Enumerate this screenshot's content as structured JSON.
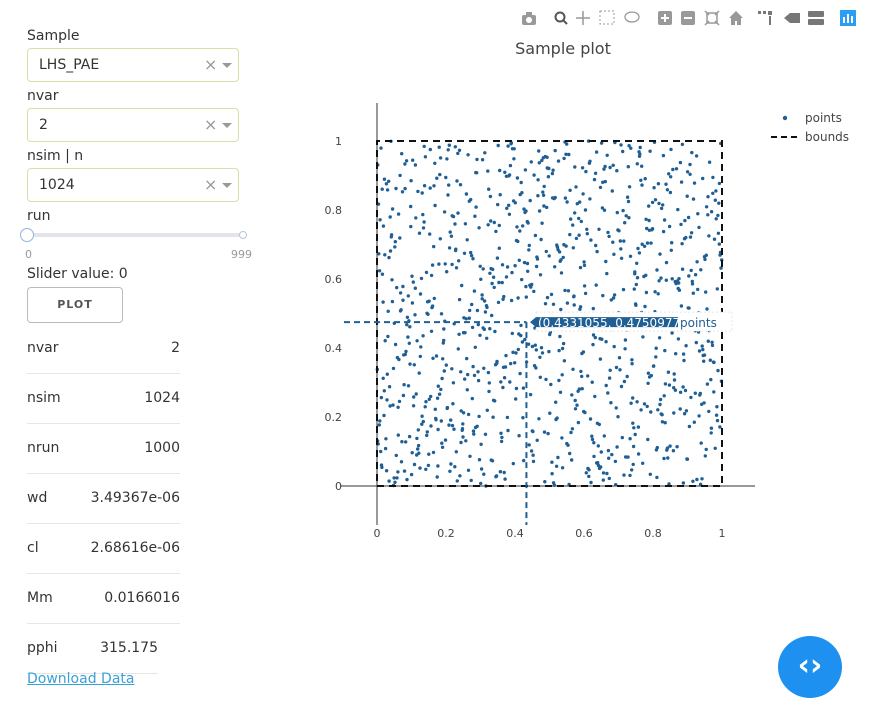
{
  "sidebar": {
    "sample_label": "Sample",
    "sample_value": "LHS_PAE",
    "nvar_label": "nvar",
    "nvar_value": "2",
    "nsim_label": "nsim | n",
    "nsim_value": "1024",
    "run_label": "run",
    "run_min": "0",
    "run_max": "999",
    "slider_value_text": "Slider value: 0",
    "plot_button": "PLOT",
    "clear_glyph": "×",
    "download_label": "Download Data"
  },
  "stats": [
    {
      "key": "nvar",
      "value": "2"
    },
    {
      "key": "nsim",
      "value": "1024"
    },
    {
      "key": "nrun",
      "value": "1000"
    },
    {
      "key": "wd",
      "value": "3.49367e-06"
    },
    {
      "key": "cl",
      "value": "2.68616e-06"
    },
    {
      "key": "Mm",
      "value": "0.0166016"
    },
    {
      "key": "pphi",
      "value": "315.175"
    }
  ],
  "chart_data": {
    "type": "scatter",
    "title": "Sample plot",
    "xlim": [
      0,
      1
    ],
    "ylim": [
      0,
      1
    ],
    "xticks": [
      "0",
      "0.2",
      "0.4",
      "0.6",
      "0.8",
      "1"
    ],
    "yticks": [
      "0",
      "0.2",
      "0.4",
      "0.6",
      "0.8",
      "1"
    ],
    "legend_position": "top-right",
    "series": [
      {
        "name": "points",
        "color": "#1f5f94",
        "n": 1024
      },
      {
        "name": "bounds",
        "color": "#111111",
        "x": [
          0,
          1,
          1,
          0,
          0
        ],
        "y": [
          0,
          0,
          1,
          1,
          0
        ]
      }
    ],
    "hover": {
      "x": 0.4331055,
      "y": 0.4750977,
      "text": "(0.4331055, 0.4750977)",
      "series": "points"
    }
  },
  "colors": {
    "accent": "#1e90f0",
    "dropdown_border": "#d8dfa8",
    "link": "#3aa0d8"
  },
  "modebar": [
    "camera-icon",
    "zoom-icon",
    "pan-icon",
    "box-select-icon",
    "lasso-icon",
    "zoom-in-icon",
    "zoom-out-icon",
    "autoscale-icon",
    "reset-icon",
    "spike-icon",
    "hover-closest-icon",
    "hover-compare-icon",
    "plotly-logo-icon"
  ],
  "fab": {
    "glyph": "‹›"
  }
}
